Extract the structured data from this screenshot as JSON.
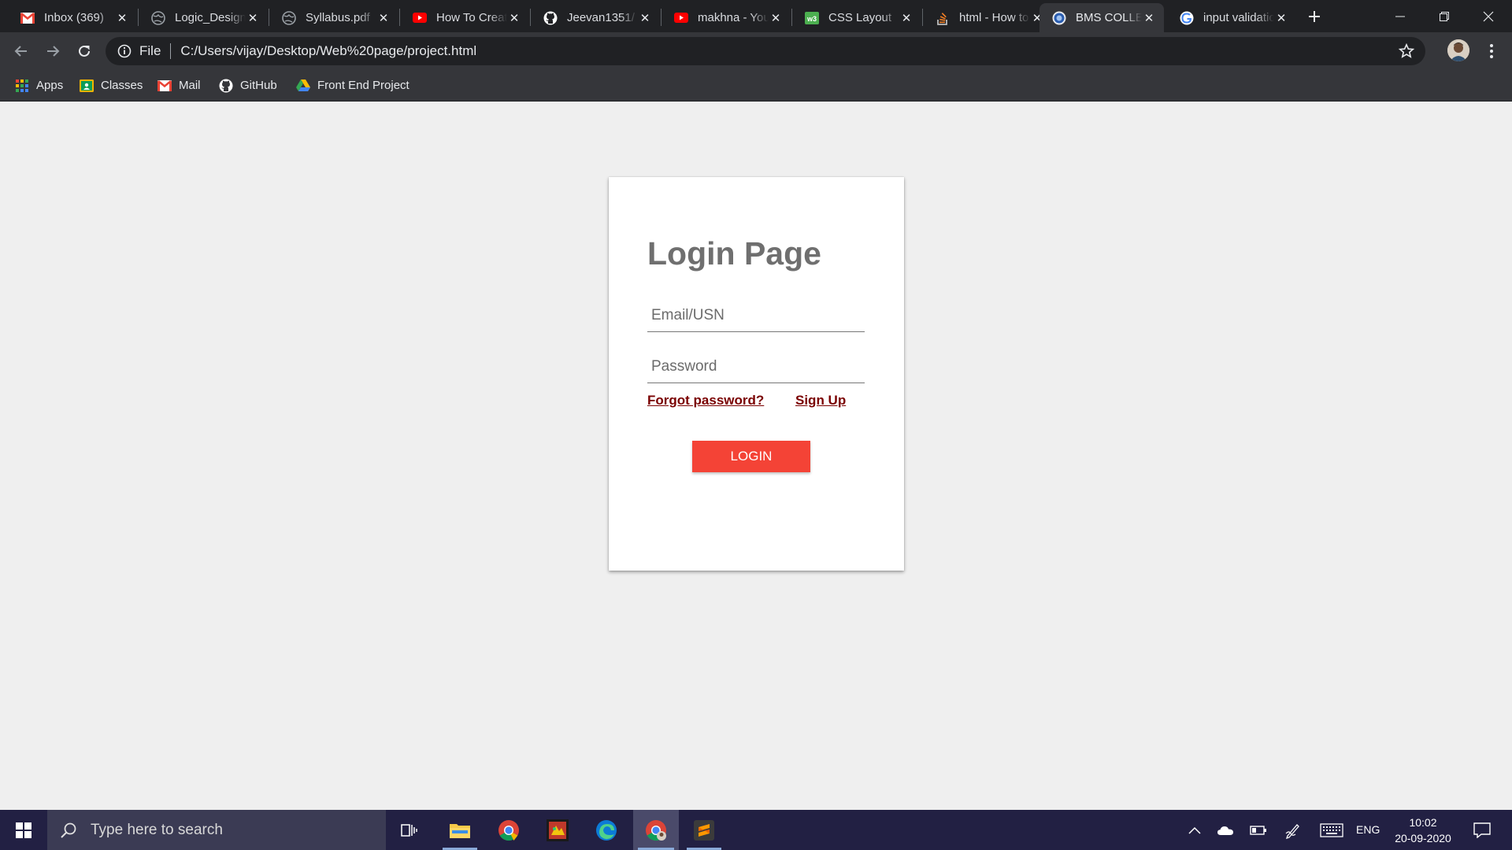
{
  "browser": {
    "tabs": [
      {
        "title": "Inbox (369)",
        "icon": "gmail-icon",
        "active": false
      },
      {
        "title": "Logic_Design",
        "icon": "globe-icon",
        "active": false
      },
      {
        "title": "Syllabus.pdf",
        "icon": "globe-icon",
        "active": false
      },
      {
        "title": "How To Create",
        "icon": "youtube-icon",
        "active": false
      },
      {
        "title": "Jeevan1351/",
        "icon": "github-icon",
        "active": false
      },
      {
        "title": "makhna - YouTube",
        "icon": "youtube-icon",
        "active": false
      },
      {
        "title": "CSS Layout",
        "icon": "w3schools-icon",
        "active": false
      },
      {
        "title": "html - How to",
        "icon": "stackoverflow-icon",
        "active": false
      },
      {
        "title": "BMS COLLEGE",
        "icon": "bms-icon",
        "active": true
      },
      {
        "title": "input validation",
        "icon": "google-icon",
        "active": false
      }
    ],
    "address": {
      "scheme_label": "File",
      "url": "C:/Users/vijay/Desktop/Web%20page/project.html"
    },
    "bookmarks": [
      {
        "label": "Apps",
        "icon": "apps-grid-icon"
      },
      {
        "label": "Classes",
        "icon": "classroom-icon"
      },
      {
        "label": "Mail",
        "icon": "gmail-icon"
      },
      {
        "label": "GitHub",
        "icon": "github-icon"
      },
      {
        "label": "Front End Project",
        "icon": "drive-icon"
      }
    ]
  },
  "login": {
    "title": "Login Page",
    "email_placeholder": "Email/USN",
    "password_placeholder": "Password",
    "forgot_label": "Forgot password?",
    "signup_label": "Sign Up",
    "login_label": "LOGIN",
    "button_color": "#f44336",
    "link_color": "#7a0000"
  },
  "taskbar": {
    "search_placeholder": "Type here to search",
    "language": "ENG",
    "time": "10:02",
    "date": "20-09-2020",
    "apps": [
      "task-view-icon",
      "file-explorer-icon",
      "chrome-icon",
      "game-app-icon",
      "edge-icon",
      "chrome-profile-icon",
      "sublime-text-icon"
    ]
  }
}
